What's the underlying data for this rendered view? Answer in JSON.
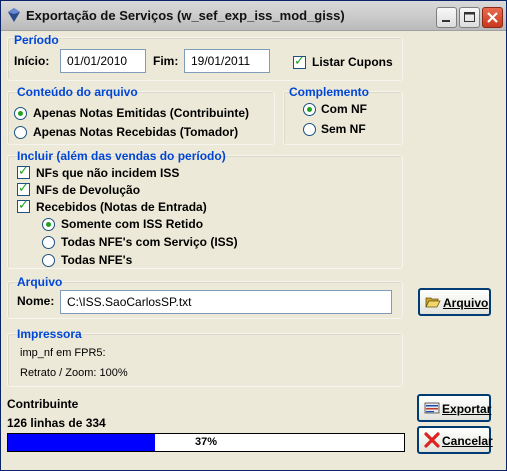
{
  "window": {
    "title": "Exportação de Serviços (w_sef_exp_iss_mod_giss)"
  },
  "periodo": {
    "title": "Período",
    "inicio_label": "Início:",
    "inicio_value": "01/01/2010",
    "fim_label": "Fim:",
    "fim_value": "19/01/2011",
    "listar_cupons_label": "Listar Cupons",
    "listar_cupons_checked": true
  },
  "conteudo": {
    "title": "Conteúdo do arquivo",
    "options": [
      "Apenas Notas Emitidas (Contribuinte)",
      "Apenas Notas Recebidas (Tomador)"
    ],
    "selected": 0
  },
  "complemento": {
    "title": "Complemento",
    "options": [
      "Com NF",
      "Sem NF"
    ],
    "selected": 0
  },
  "incluir": {
    "title": "Incluir (além das vendas do período)",
    "checks": [
      "NFs que não incidem ISS",
      "NFs de Devolução",
      "Recebidos (Notas de Entrada)"
    ],
    "sub_options": [
      "Somente com ISS Retido",
      "Todas NFE's com Serviço (ISS)",
      "Todas NFE's"
    ],
    "sub_selected": 0
  },
  "arquivo": {
    "title": "Arquivo",
    "nome_label": "Nome:",
    "nome_value": "C:\\ISS.SaoCarlosSP.txt",
    "button_accel": "A",
    "button_rest": "rquivo"
  },
  "impressora": {
    "title": "Impressora",
    "line1": "imp_nf em FPR5:",
    "line2": "Retrato / Zoom: 100%"
  },
  "status": {
    "entity": "Contribuinte",
    "lines": "126 linhas de 334",
    "progress_text": "37%",
    "progress_fraction": 0.37
  },
  "buttons": {
    "exportar_accel": "E",
    "exportar_rest": "xportar",
    "cancelar_accel": "C",
    "cancelar_rest": "ancelar"
  }
}
